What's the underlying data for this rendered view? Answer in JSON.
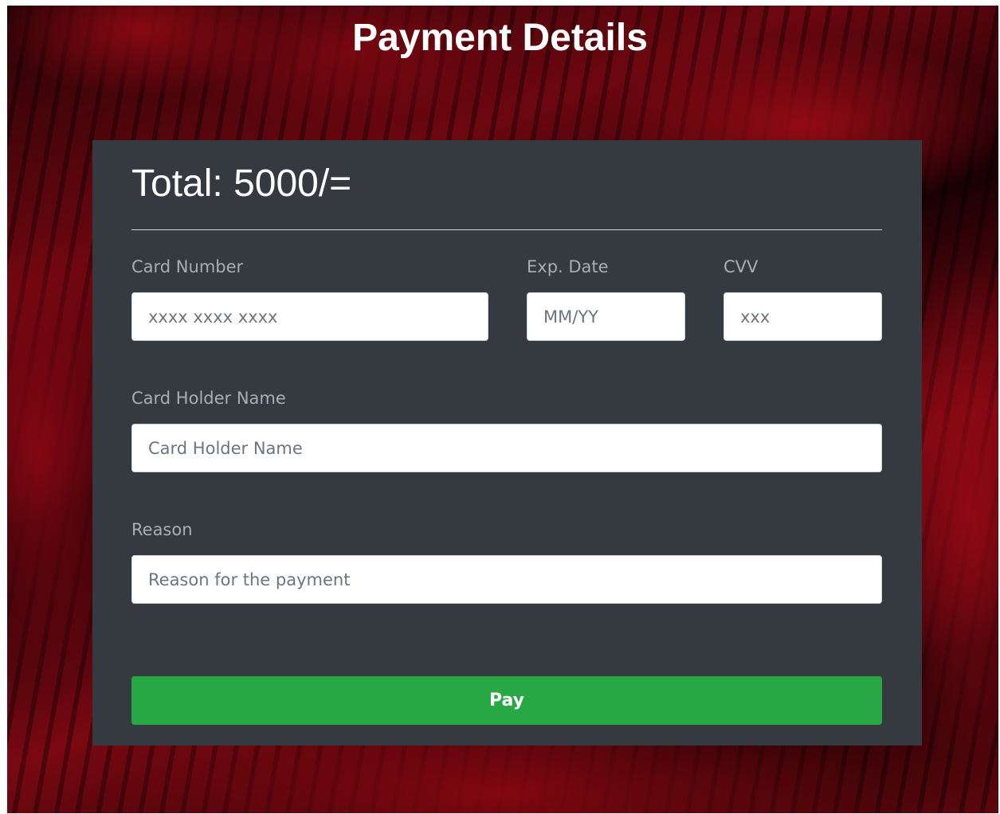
{
  "page": {
    "title": "Payment Details"
  },
  "form": {
    "total": "Total: 5000/=",
    "card_number": {
      "label": "Card Number",
      "placeholder": "xxxx xxxx xxxx",
      "value": ""
    },
    "exp_date": {
      "label": "Exp. Date",
      "placeholder": "MM/YY",
      "value": ""
    },
    "cvv": {
      "label": "CVV",
      "placeholder": "xxx",
      "value": ""
    },
    "card_holder": {
      "label": "Card Holder Name",
      "placeholder": "Card Holder Name",
      "value": ""
    },
    "reason": {
      "label": "Reason",
      "placeholder": "Reason for the payment",
      "value": ""
    },
    "pay_label": "Pay"
  },
  "colors": {
    "card_background": "#343a40",
    "pay_button": "#28a745",
    "label_text": "#a7aeb5",
    "background_accent": "#7a0812"
  }
}
